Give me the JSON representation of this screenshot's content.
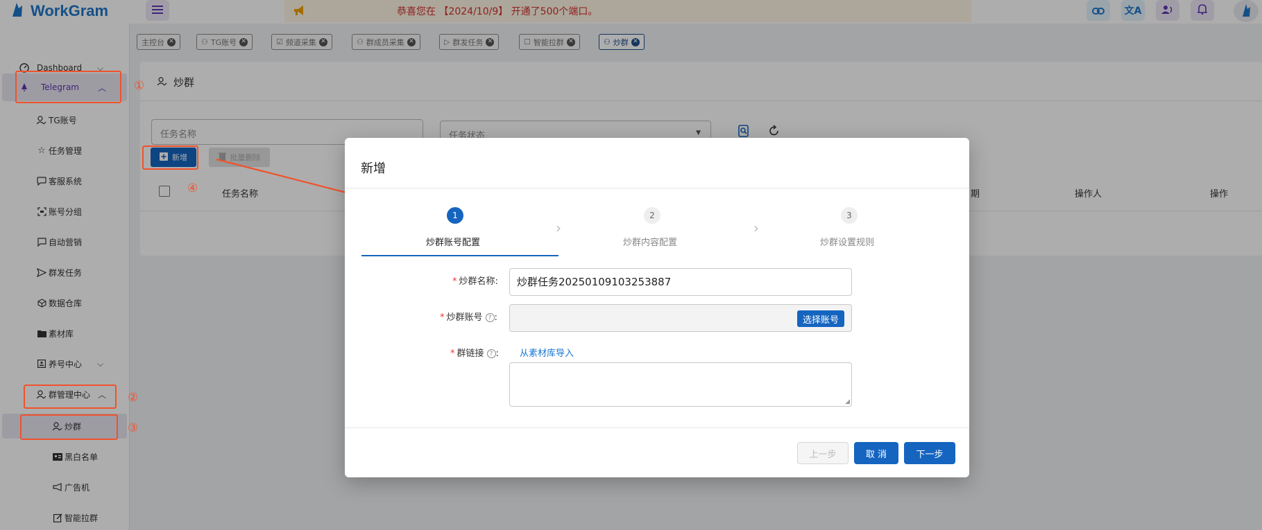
{
  "app": {
    "title": "WorkGram"
  },
  "notice": {
    "text": "恭喜您在 【2024/10/9】 开通了500个端口。"
  },
  "sidebar": {
    "items": [
      {
        "label": "Dashboard"
      },
      {
        "label": "Telegram"
      },
      {
        "label": "TG账号"
      },
      {
        "label": "任务管理"
      },
      {
        "label": "客服系统"
      },
      {
        "label": "账号分组"
      },
      {
        "label": "自动营销"
      },
      {
        "label": "群发任务"
      },
      {
        "label": "数据仓库"
      },
      {
        "label": "素材库"
      },
      {
        "label": "养号中心"
      },
      {
        "label": "群管理中心"
      },
      {
        "label": "炒群"
      },
      {
        "label": "黑白名单"
      },
      {
        "label": "广告机"
      },
      {
        "label": "智能拉群"
      }
    ]
  },
  "annotations": {
    "m1": "①",
    "m2": "②",
    "m3": "③",
    "m4": "④"
  },
  "tabs": [
    {
      "label": "主控台"
    },
    {
      "label": "TG账号"
    },
    {
      "label": "频道采集"
    },
    {
      "label": "群成员采集"
    },
    {
      "label": "群发任务"
    },
    {
      "label": "智能拉群"
    },
    {
      "label": "炒群"
    }
  ],
  "page": {
    "title": "炒群"
  },
  "filters": {
    "task_name_placeholder": "任务名称",
    "task_status_placeholder": "任务状态"
  },
  "toolbar": {
    "add_label": "新增",
    "batch_delete_label": "批量删除"
  },
  "table": {
    "headers": [
      "任务名称",
      "日期",
      "操作人",
      "操作"
    ]
  },
  "modal": {
    "title": "新增",
    "steps": [
      {
        "num": "1",
        "label": "炒群账号配置"
      },
      {
        "num": "2",
        "label": "炒群内容配置"
      },
      {
        "num": "3",
        "label": "炒群设置规则"
      }
    ],
    "fields": {
      "name_label": "炒群名称:",
      "name_value": "炒群任务20250109103253887",
      "account_label": "炒群账号",
      "account_button": "选择账号",
      "link_label": "群链接",
      "link_import": "从素材库导入"
    },
    "buttons": {
      "prev": "上一步",
      "cancel": "取 消",
      "next": "下一步"
    }
  },
  "colors": {
    "primary": "#1565c0",
    "accent_red": "#f0522c",
    "purple": "#5e35b1"
  }
}
